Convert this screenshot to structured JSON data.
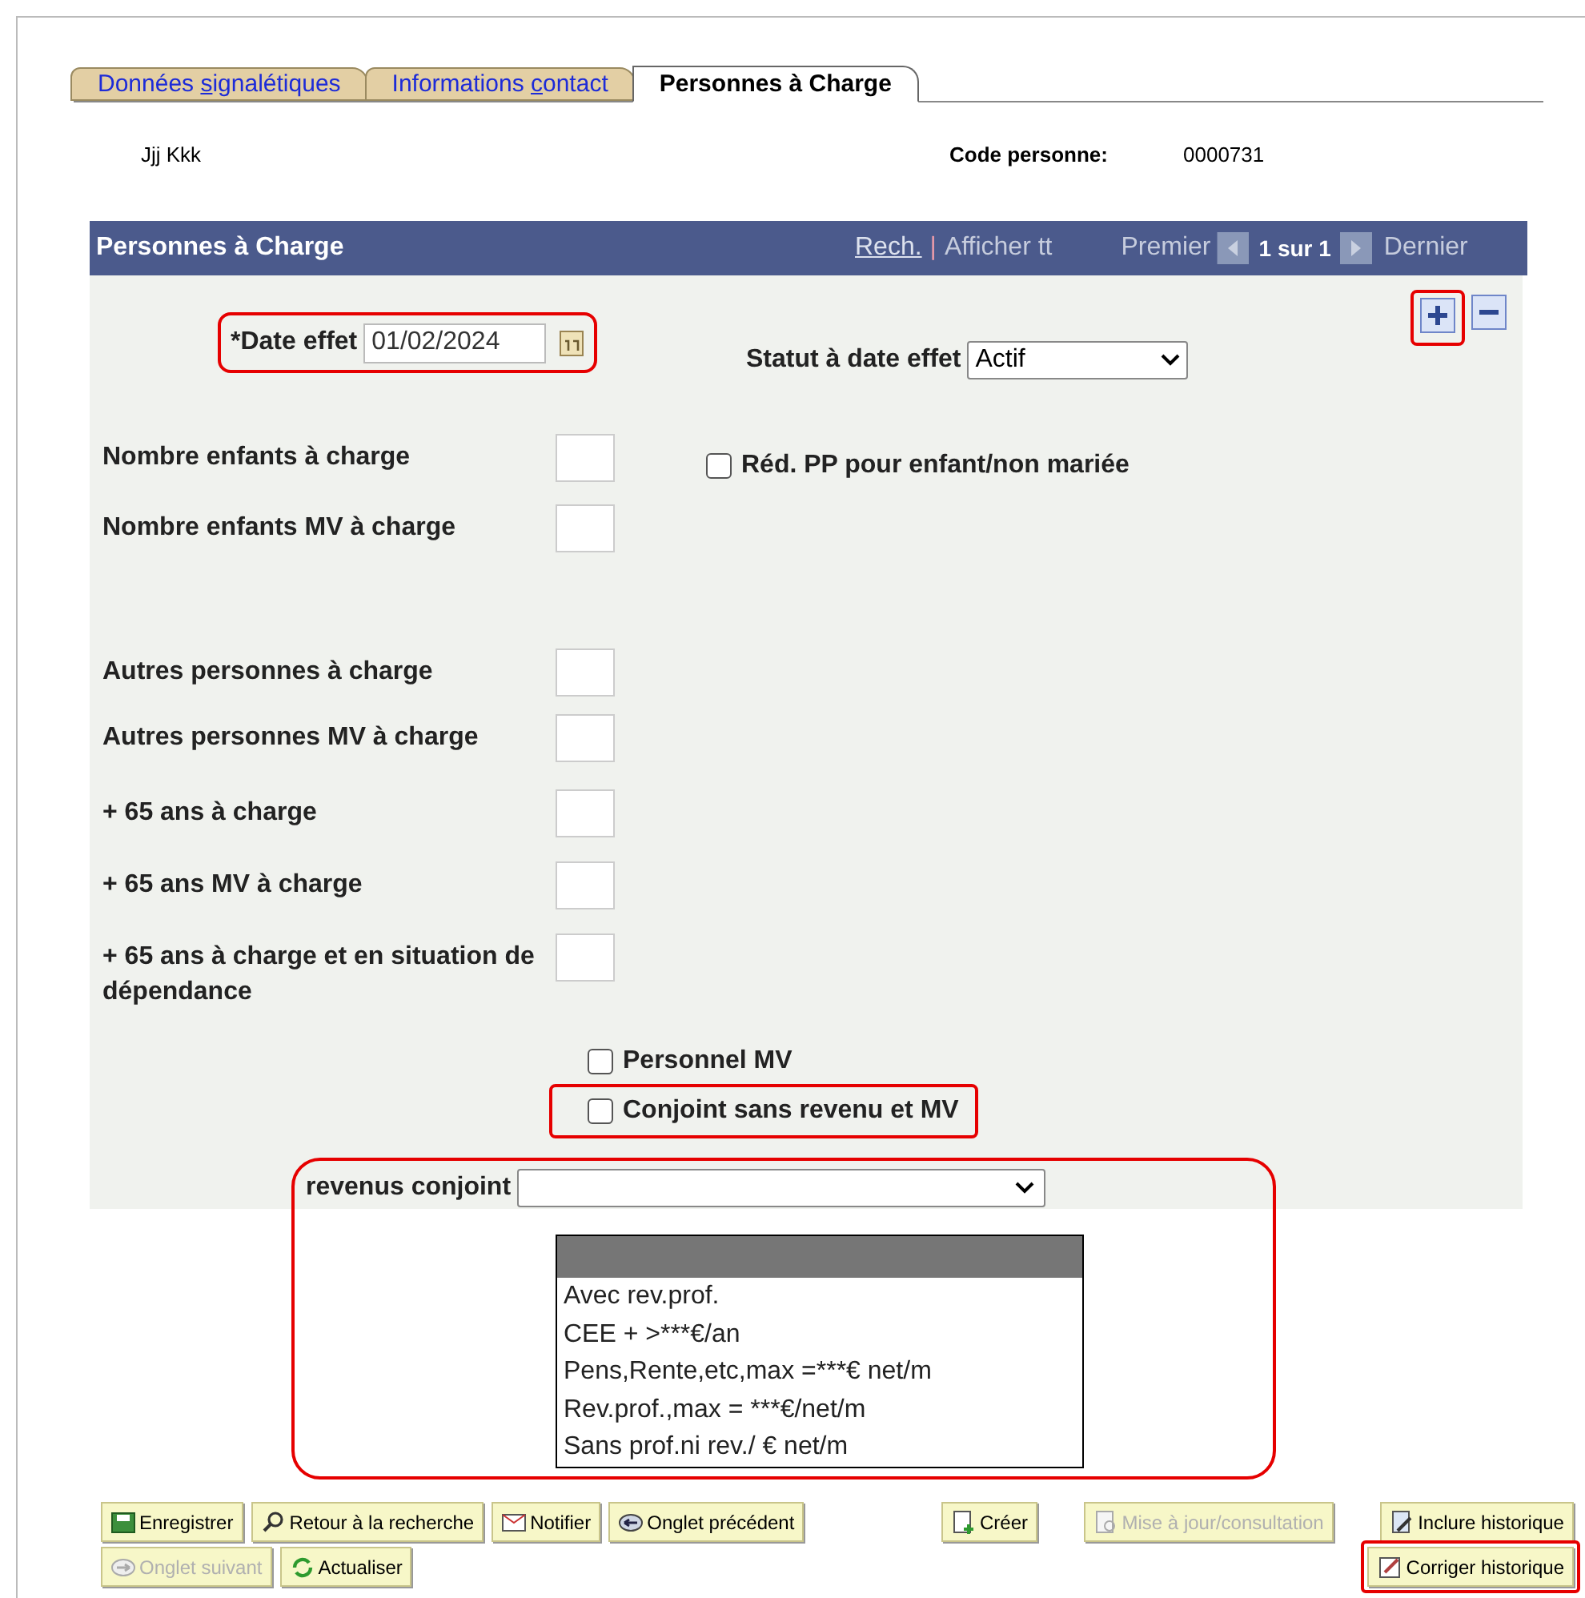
{
  "tabs": [
    {
      "label": "Données ",
      "access": "s",
      "rest": "ignalétiques",
      "selected": false
    },
    {
      "label": "Informations ",
      "access": "c",
      "rest": "ontact",
      "selected": false
    },
    {
      "label": "Personnes à Charge",
      "selected": true
    }
  ],
  "person": {
    "name": "Jjj Kkk",
    "code_label": "Code personne:",
    "code": "0000731"
  },
  "panel": {
    "title": "Personnes à Charge",
    "search_link": "Rech.",
    "separator": "|",
    "show_all": "Afficher tt",
    "first": "Premier",
    "count": "1 sur 1",
    "last": "Dernier",
    "add_highlighted": true
  },
  "date": {
    "label": "*Date effet",
    "value": "01/02/2024",
    "highlighted": true
  },
  "status": {
    "label": "Statut à date effet",
    "value": "Actif"
  },
  "number_fields": [
    {
      "label": "Nombre enfants à charge"
    },
    {
      "label": "Nombre enfants MV à charge"
    },
    {
      "label": "Autres personnes à charge"
    },
    {
      "label": "Autres personnes MV à charge"
    },
    {
      "label": "+ 65 ans à charge"
    },
    {
      "label": "+ 65 ans MV à charge"
    },
    {
      "label": "+ 65 ans à charge et en situation de dépendance"
    }
  ],
  "pp_checkbox": {
    "label": "Réd. PP pour enfant/non mariée",
    "checked": false
  },
  "checkboxes": [
    {
      "label": "Personnel MV",
      "checked": false,
      "highlighted": false
    },
    {
      "label": "Conjoint sans revenu et MV",
      "checked": false,
      "highlighted": true
    }
  ],
  "spouse_income": {
    "label": "revenus conjoint",
    "open": true,
    "highlighted": true,
    "blank_highlighted": true,
    "options": [
      {
        "label": "Avec rev.prof."
      },
      {
        "label": "CEE + >***€/an"
      },
      {
        "label": "Pens,Rente,etc,max =***€ net/m"
      },
      {
        "label": "Rev.prof.,max = ***€/net/m"
      },
      {
        "label": "Sans prof.ni rev./ € net/m"
      }
    ]
  },
  "buttons_left": [
    [
      {
        "label": "Enregistrer",
        "kind": "save",
        "disabled": false
      },
      {
        "label": "Retour à la recherche",
        "kind": "search",
        "disabled": false
      },
      {
        "label": "Notifier",
        "kind": "notify",
        "disabled": false
      },
      {
        "label": "Onglet précédent",
        "kind": "prev",
        "disabled": false
      }
    ],
    [
      {
        "label": "Onglet suivant",
        "kind": "next",
        "disabled": true
      },
      {
        "label": "Actualiser",
        "kind": "refresh",
        "disabled": false
      }
    ]
  ],
  "buttons_right": [
    [
      {
        "label": "Créer",
        "kind": "create",
        "disabled": false,
        "highlighted": false
      },
      {
        "label": "Mise à jour/consultation",
        "kind": "update",
        "disabled": true,
        "highlighted": false
      },
      {
        "label": "Inclure historique",
        "kind": "include",
        "disabled": false,
        "highlighted": false
      }
    ],
    [
      {
        "label": "Corriger historique",
        "kind": "correct",
        "disabled": false,
        "highlighted": true
      }
    ]
  ]
}
